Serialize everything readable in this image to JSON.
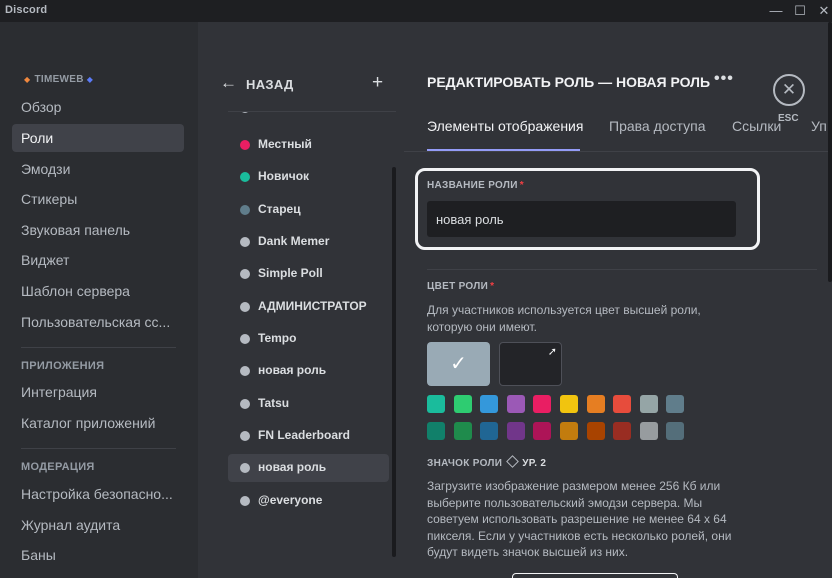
{
  "window": {
    "title": "Discord",
    "min_icon": "—",
    "max_icon": "☐",
    "close_icon": "✕"
  },
  "sidebar": {
    "guild_name": "TIMEWEB",
    "items_top": [
      {
        "label": "Обзор",
        "active": false
      },
      {
        "label": "Роли",
        "active": true
      },
      {
        "label": "Эмодзи",
        "active": false
      },
      {
        "label": "Стикеры",
        "active": false
      },
      {
        "label": "Звуковая панель",
        "active": false
      },
      {
        "label": "Виджет",
        "active": false
      },
      {
        "label": "Шаблон сервера",
        "active": false
      },
      {
        "label": "Пользовательская сс...",
        "active": false
      }
    ],
    "apps_header": "ПРИЛОЖЕНИЯ",
    "apps_items": [
      "Интеграция",
      "Каталог приложений"
    ],
    "moderation_header": "МОДЕРАЦИЯ",
    "moderation_items": [
      "Настройка безопасно...",
      "Журнал аудита",
      "Баны"
    ]
  },
  "roles_panel": {
    "back_label": "НАЗАД",
    "back_icon": "arrow-left-icon",
    "add_icon": "plus-icon",
    "roles": [
      {
        "name": "Местный",
        "color": "#e91e63",
        "active": false
      },
      {
        "name": "Новичок",
        "color": "#1abc9c",
        "active": false
      },
      {
        "name": "Старец",
        "color": "#607d8b",
        "active": false
      },
      {
        "name": "Dank Memer",
        "color": "#b5bac1",
        "active": false
      },
      {
        "name": "Simple Poll",
        "color": "#b5bac1",
        "active": false
      },
      {
        "name": "АДМИНИСТРАТОР",
        "color": "#b5bac1",
        "active": false
      },
      {
        "name": "Tempo",
        "color": "#b5bac1",
        "active": false
      },
      {
        "name": "новая роль",
        "color": "#b5bac1",
        "active": false
      },
      {
        "name": "Tatsu",
        "color": "#b5bac1",
        "active": false
      },
      {
        "name": "FN Leaderboard",
        "color": "#b5bac1",
        "active": false
      },
      {
        "name": "новая роль",
        "color": "#b5bac1",
        "active": true
      },
      {
        "name": "@everyone",
        "color": "#b5bac1",
        "active": false
      }
    ]
  },
  "editor": {
    "title": "РЕДАКТИРОВАТЬ РОЛЬ — НОВАЯ РОЛЬ",
    "more_icon": "•••",
    "close_icon": "✕",
    "esc_label": "ESC",
    "tabs": [
      {
        "label": "Элементы отображения",
        "active": true
      },
      {
        "label": "Права доступа",
        "active": false
      },
      {
        "label": "Ссылки",
        "active": false
      },
      {
        "label": "Уп",
        "active": false
      }
    ],
    "role_name_label": "НАЗВАНИЕ РОЛИ",
    "required_mark": "*",
    "role_name_value": "новая роль",
    "role_color_label": "ЦВЕТ РОЛИ",
    "role_color_desc": "Для участников используется цвет высшей роли, которую они имеют.",
    "default_check": "✓",
    "picker_icon": "➚",
    "swatches_row1": [
      "#1abc9c",
      "#2ecc71",
      "#3498db",
      "#9b59b6",
      "#e91e63",
      "#f1c40f",
      "#e67e22",
      "#e74c3c",
      "#95a5a6",
      "#607d8b"
    ],
    "swatches_row2": [
      "#11806a",
      "#1f8b4c",
      "#206694",
      "#71368a",
      "#ad1457",
      "#c27c0e",
      "#a84300",
      "#992d22",
      "#979c9f",
      "#546e7a"
    ],
    "role_icon_label": "ЗНАЧОК РОЛИ",
    "role_icon_level": "УР. 2",
    "role_icon_desc": "Загрузите изображение размером менее 256 Кб или выберите пользовательский эмодзи сервера. Мы советуем использовать разрешение не менее 64 x 64 пикселя. Если у участников есть несколько ролей, они будут видеть значок высшей из них."
  }
}
